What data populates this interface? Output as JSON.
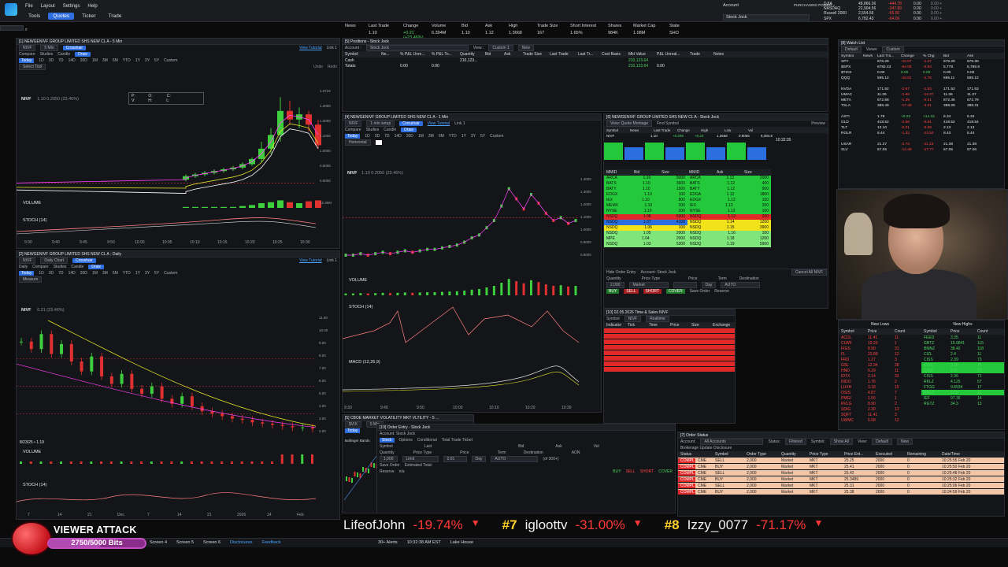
{
  "menu": [
    "File",
    "Layout",
    "Settings",
    "Help"
  ],
  "submenu": [
    {
      "label": "Tools",
      "active": false
    },
    {
      "label": "Quotes",
      "active": true
    },
    {
      "label": "Ticker",
      "active": false
    },
    {
      "label": "Trade",
      "active": false
    }
  ],
  "account": {
    "label": "Account",
    "value": "Stock Jock",
    "power_label": "PURCHASING POWER ="
  },
  "indices": [
    {
      "name": "DJIA",
      "value": "48,866.36",
      "change": "-444.78"
    },
    {
      "name": "NASDAQ",
      "value": "22,904.56",
      "change": "-347.89"
    },
    {
      "name": "Russell 2000",
      "value": "2,554.56",
      "change": "-55.00"
    },
    {
      "name": "SPX",
      "value": "6,782.43",
      "change": "-64.09"
    }
  ],
  "index_extra": [
    {
      "value": "0.00",
      "change": "0.00 +"
    },
    {
      "value": "0.00",
      "change": "0.00 +"
    },
    {
      "value": "0.00",
      "change": "0.00 +"
    },
    {
      "value": "0.00",
      "change": "0.00 +"
    }
  ],
  "quote_strip": {
    "labels": [
      "News",
      "Last Trade",
      "Change",
      "Volume",
      "Bid",
      "Ask",
      "High",
      "Trade Size",
      "Short Interest",
      "Shares",
      "Market Cap",
      "State"
    ],
    "values": [
      "",
      "1.10",
      "+0.21 (+23.46%)",
      "6.394M",
      "1.10",
      "1.12",
      "1.3668",
      "167",
      "1.65%",
      "984K",
      "1.08M",
      "SHO"
    ]
  },
  "positions": {
    "title": "[5] Positions - Stock Jock",
    "account": "Stock Jock",
    "view": "Custom 1",
    "new_label": "New",
    "columns": [
      "Symbol",
      "Ne...",
      "% P&L Unre...",
      "% P&L To...",
      "Quantity",
      "Bid",
      "Ask",
      "Trade Size",
      "Last Trade",
      "Last Tr...",
      "Cost Basis",
      "Mkt Value",
      "P&L Unreal...",
      "Trade",
      "Notes"
    ],
    "rows": [
      [
        "Cash",
        "",
        "",
        "",
        "210,123...",
        "",
        "",
        "",
        "",
        "",
        "",
        "210,123.64",
        "",
        "",
        ""
      ],
      [
        "Totals:",
        "",
        "0.00",
        "0.00",
        "",
        "",
        "",
        "",
        "",
        "",
        "",
        "210,123.64",
        "0.00",
        "",
        ""
      ]
    ]
  },
  "chart1": {
    "title": "[1] NEWGENIVF GROUP LIMITED SHS NEW CL A - 5 Min",
    "symbol": "NIVF",
    "timeframe": "5 Min",
    "tools": [
      "Compare",
      "Studies",
      "Candle",
      "Draw",
      "Crosshair"
    ],
    "tutorial": "View Tutorial",
    "link": "Link 1",
    "ranges": [
      "Today",
      "1D",
      "3D",
      "7D",
      "14D",
      "20D",
      "1M",
      "3M",
      "6M",
      "YTD",
      "1Y",
      "3Y",
      "5Y",
      "Custom"
    ],
    "select_tool": "Select Tool",
    "undo": "Undo",
    "redo": "Redo",
    "legend": "NIVF",
    "legend_price": "1.10 0.2050 (23.46%)",
    "ohlc": [
      "P:",
      "O:",
      "C:",
      "V:",
      "H:",
      "L:"
    ],
    "panes": [
      "VOLUME",
      "STOCH (14)"
    ],
    "times": [
      "9:30",
      "9:40",
      "9:45",
      "9:50",
      "10:00",
      "10:05",
      "10:10",
      "10:15",
      "10:20",
      "10:25",
      "10:30"
    ],
    "price_ticks": [
      "1.6722",
      "1.3000",
      "1.2000",
      "1.1000",
      "1.0000",
      "0.9000",
      "0.8000"
    ],
    "volume_label": "12.36M",
    "candles": [
      {
        "o": 0.9,
        "c": 0.92,
        "h": 0.93,
        "l": 0.89,
        "v": 1
      },
      {
        "o": 0.92,
        "c": 0.93,
        "h": 0.94,
        "l": 0.91,
        "v": 1
      },
      {
        "o": 0.93,
        "c": 0.94,
        "h": 0.95,
        "l": 0.92,
        "v": 1
      },
      {
        "o": 0.94,
        "c": 0.95,
        "h": 0.96,
        "l": 0.93,
        "v": 1
      },
      {
        "o": 0.95,
        "c": 0.96,
        "h": 0.97,
        "l": 0.94,
        "v": 1
      },
      {
        "o": 0.96,
        "c": 0.97,
        "h": 0.98,
        "l": 0.95,
        "v": 1
      },
      {
        "o": 0.97,
        "c": 0.99,
        "h": 1.0,
        "l": 0.96,
        "v": 2
      },
      {
        "o": 0.99,
        "c": 1.02,
        "h": 1.03,
        "l": 0.98,
        "v": 3
      },
      {
        "o": 1.02,
        "c": 1.08,
        "h": 1.12,
        "l": 1.0,
        "v": 5
      },
      {
        "o": 1.08,
        "c": 1.16,
        "h": 1.2,
        "l": 1.05,
        "v": 6
      },
      {
        "o": 1.16,
        "c": 1.3,
        "h": 1.38,
        "l": 1.12,
        "v": 8
      },
      {
        "o": 1.3,
        "c": 1.25,
        "h": 1.36,
        "l": 1.22,
        "v": 6
      },
      {
        "o": 1.25,
        "c": 1.28,
        "h": 1.32,
        "l": 1.2,
        "v": 5
      },
      {
        "o": 1.28,
        "c": 1.22,
        "h": 1.3,
        "l": 1.18,
        "v": 7
      },
      {
        "o": 1.22,
        "c": 1.1,
        "h": 1.25,
        "l": 1.08,
        "v": 8
      }
    ]
  },
  "chart2": {
    "title": "[4] NEWGENIVF GROUP LIMITED SHS NEW CL A - 1 Min",
    "symbol": "NIVF",
    "setup": "1 min setup",
    "tutorial": "View Tutorial",
    "link": "Link 1",
    "ranges": [
      "Today",
      "1D",
      "3D",
      "7D",
      "14D",
      "20D",
      "1M",
      "3M",
      "6M",
      "YTD",
      "1Y",
      "3Y",
      "5Y",
      "Custom"
    ],
    "draw_mode": "Horizontal",
    "legend": "NIVF",
    "legend_price": "1.10 0.2050 (23.46%)",
    "panes": [
      "VOLUME",
      "STOCH (14)",
      "MACD (12,26,9)"
    ],
    "times": [
      "9:30",
      "9:40",
      "9:50",
      "10:00",
      "10:10",
      "10:20",
      "10:30"
    ],
    "price_ticks": [
      "1.4000",
      "1.3000",
      "1.2000",
      "1.1000",
      "1.0000",
      "0.9000",
      "0.8000"
    ],
    "prices": [
      0.86,
      0.86,
      0.87,
      0.86,
      0.87,
      0.88,
      0.87,
      0.88,
      0.89,
      0.88,
      0.89,
      0.9,
      0.9,
      0.91,
      0.92,
      0.93,
      0.95,
      0.98,
      1.0,
      1.05,
      1.1,
      1.2,
      1.32,
      1.25,
      1.18,
      1.28,
      1.22,
      1.15,
      1.1,
      1.12,
      1.08,
      1.1
    ]
  },
  "chart3": {
    "title": "[2] NEWGENIVF GROUP LIMITED SHS NEW CL A - Daily",
    "symbol": "NIVF",
    "timeframe": "Daily",
    "chart": "Daily Chart",
    "tutorial": "View Tutorial",
    "link": "Link 1",
    "ranges": [
      "Today",
      "1D",
      "3D",
      "7D",
      "14D",
      "20D",
      "1M",
      "3M",
      "6M",
      "YTD",
      "1Y",
      "3Y",
      "5Y",
      "Custom"
    ],
    "measure": "Measure",
    "legend": "NIVF",
    "legend_price": "6.21 (23.46%)",
    "panes": [
      "VOLUME",
      "STOCH (14)"
    ],
    "dates": [
      "7",
      "14",
      "21",
      "Dec",
      "7",
      "14",
      "21",
      "2026",
      "14",
      "Feb"
    ],
    "date_marker": "8/23/25 • 1.19",
    "price_ticks": [
      "11.00",
      "10.00",
      "9.00",
      "8.00",
      "7.00",
      "6.00",
      "5.00",
      "4.00",
      "3.00",
      "2.00"
    ],
    "prices": [
      8.8,
      8.2,
      9.4,
      7.8,
      8.6,
      7.2,
      6.4,
      7.6,
      6.0,
      5.4,
      6.2,
      5.0,
      4.6,
      5.2,
      4.2,
      3.8,
      4.4,
      3.6,
      3.2,
      3.0,
      2.8,
      2.6,
      2.5,
      2.3,
      2.2,
      2.1,
      2.0,
      1.9,
      1.9,
      1.8
    ]
  },
  "vix": {
    "title": "[5] CBOE MARKET VOLATILITY MKT VLTILITY - 5 ...",
    "symbol": "$VIX",
    "timeframe": "5 Min",
    "today": "Today",
    "studies": "Bollinger Bands"
  },
  "level2": {
    "title": "[6] NEWGENIVF GROUP LIMITED SHS NEW CL A - Stock Jock",
    "view": "View: Quote Montage",
    "find": "Find Symbol",
    "preview": "Preview",
    "symbol": "NIVF",
    "quote_cols": [
      "Symbol",
      "News",
      "Last Trade",
      "Change",
      "High",
      "Low",
      "Vol"
    ],
    "quote_vals": [
      "NIVF",
      "",
      "1.10",
      "+0.209",
      "+0.23",
      "1.3668",
      "0.9056",
      "6,394.6"
    ],
    "time": "10:32:35",
    "book_cols": [
      "MMID",
      "Bid",
      "Size",
      "MMID",
      "Ask",
      "Size"
    ],
    "bids": [
      {
        "mmid": "ARCA",
        "price": "1.10",
        "size": "5000",
        "c": "g"
      },
      {
        "mmid": "BATS",
        "price": "1.10",
        "size": "3600",
        "c": "g"
      },
      {
        "mmid": "BATY",
        "price": "1.10",
        "size": "1500",
        "c": "g"
      },
      {
        "mmid": "EDGX",
        "price": "1.10",
        "size": "100",
        "c": "g"
      },
      {
        "mmid": "IEX",
        "price": "1.10",
        "size": "800",
        "c": "g"
      },
      {
        "mmid": "MEMX",
        "price": "1.10",
        "size": "200",
        "c": "g"
      },
      {
        "mmid": "NYSE",
        "price": "1.10",
        "size": "200",
        "c": "g"
      },
      {
        "mmid": "NSDQ",
        "price": "1.08",
        "size": "5300",
        "c": "rd"
      },
      {
        "mmid": "NSDQ",
        "price": "1.07",
        "size": "4100",
        "c": "bl"
      },
      {
        "mmid": "NSDQ",
        "price": "1.06",
        "size": "100",
        "c": "yl"
      },
      {
        "mmid": "NSDQ",
        "price": "1.05",
        "size": "2000",
        "c": "lg"
      },
      {
        "mmid": "MPE",
        "price": "1.04",
        "size": "2000",
        "c": "lg"
      },
      {
        "mmid": "NSDQ",
        "price": "1.03",
        "size": "5300",
        "c": "lg"
      }
    ],
    "asks": [
      {
        "mmid": "ARCA",
        "price": "1.12",
        "size": "2000",
        "c": "g"
      },
      {
        "mmid": "BATS",
        "price": "1.12",
        "size": "400",
        "c": "g"
      },
      {
        "mmid": "BATY",
        "price": "1.12",
        "size": "900",
        "c": "g"
      },
      {
        "mmid": "EDGA",
        "price": "1.12",
        "size": "1800",
        "c": "g"
      },
      {
        "mmid": "EDGX",
        "price": "1.12",
        "size": "100",
        "c": "g"
      },
      {
        "mmid": "IEX",
        "price": "1.12",
        "size": "200",
        "c": "g"
      },
      {
        "mmid": "NYSE",
        "price": "1.12",
        "size": "100",
        "c": "g"
      },
      {
        "mmid": "NSDQ",
        "price": "1.13",
        "size": "200",
        "c": "rd"
      },
      {
        "mmid": "NSDQ",
        "price": "1.14",
        "size": "1200",
        "c": "yl"
      },
      {
        "mmid": "NSDQ",
        "price": "1.15",
        "size": "3900",
        "c": "yl"
      },
      {
        "mmid": "NSDQ",
        "price": "1.16",
        "size": "100",
        "c": "lg"
      },
      {
        "mmid": "NSDQ",
        "price": "1.18",
        "size": "1200",
        "c": "lg"
      },
      {
        "mmid": "NSDQ",
        "price": "1.19",
        "size": "5900",
        "c": "lg"
      }
    ],
    "order_entry": {
      "hide": "Hide Order Entry",
      "account": "Account: Stock Jock",
      "cancel": "Cancel All NIVF",
      "qty_label": "Quantity",
      "qty": "2,000",
      "price_type_label": "Price Type",
      "price_type": "Market",
      "price_label": "Price",
      "term_label": "Term",
      "term": "Day",
      "dest_label": "Destination",
      "dest": "AUTO",
      "buttons": [
        "BUY",
        "SELL",
        "SHORT",
        "COVER"
      ],
      "save_order": "Save Order",
      "reserve": "Reserve"
    }
  },
  "tns": {
    "title": "[10] 02.05.2026 Time & Sales NIVF",
    "symbol": "NIVF",
    "mode": "Realtime",
    "columns": [
      "Indicator",
      "Tick",
      "Time",
      "Price",
      "Size",
      "Exchange"
    ]
  },
  "order_entry2": {
    "title": "[19] Order Entry - Stock Jock",
    "account": "Account: Stock Jock",
    "tabs": [
      "Stock",
      "Options",
      "Conditional",
      "Total Trade Ticket"
    ],
    "labels": [
      "Symbol",
      "Last",
      "Bid",
      "Ask",
      "Vol"
    ],
    "qty_label": "Quantity",
    "qty": "1,000",
    "price_type_label": "Price Type",
    "price_type": "Limit",
    "price_label": "Price",
    "price": "2.01",
    "term_label": "Term",
    "term": "Day",
    "dest_label": "Destination",
    "dest": "AUTO",
    "aon": "AON",
    "of": "(of 300+)",
    "save_order": "Save Order",
    "reserve": "Reserve",
    "est_total": "Estimated Total:",
    "est_value": "n/a",
    "buttons": [
      "BUY",
      "SELL",
      "SHORT",
      "COVER"
    ]
  },
  "watchlist": {
    "title": "[8] Watch List",
    "view": "Custom",
    "list": "Default",
    "columns": [
      "Symbol",
      "News",
      "Last Tra...",
      "Change",
      "% Chg",
      "Bid",
      "Ask"
    ],
    "rows": [
      [
        "SPY",
        "",
        "676.29",
        "-10.07",
        "-1.47",
        "676.29",
        "676.30"
      ],
      [
        "$SPX",
        "",
        "6782.43",
        "-64.09",
        "-0.94",
        "5,779.",
        "6,786.6"
      ],
      [
        "$TICK",
        "",
        "0.00",
        "0.00",
        "0.00",
        "0.00",
        "0.00"
      ],
      [
        "QQQ",
        "",
        "595.12",
        "-10.51",
        "-1.76",
        "595.11",
        "595.12"
      ],
      [
        "",
        "",
        "",
        "",
        "",
        "",
        ""
      ],
      [
        "NVDA",
        "",
        "171.52",
        "-2.67",
        "-1.53",
        "171.52",
        "171.53"
      ],
      [
        "UMAC",
        "",
        "11.36",
        "-1.89",
        "-14.27",
        "11.36",
        "11.37"
      ],
      [
        "META",
        "",
        "672.68",
        "-1.39",
        "-0.21",
        "672.46",
        "672.79"
      ],
      [
        "TSLA",
        "",
        "388.49",
        "-17.48",
        "-4.31",
        "388.28",
        "388.31"
      ],
      [
        "",
        "",
        "",
        "",
        "",
        "",
        ""
      ],
      [
        "ASTI",
        "",
        "1.78",
        "+0.22",
        "+14.15",
        "6.34",
        "6.34"
      ],
      [
        "GLD",
        "",
        "418.52",
        "-2.56",
        "-0.61",
        "418.52",
        "418.54"
      ],
      [
        "TLT",
        "",
        "13.10",
        "-0.01",
        "-0.08",
        "2.13",
        "2.13"
      ],
      [
        "ROLR",
        "",
        "8.44",
        "-1.32",
        "-13.52",
        "8.43",
        "8.44"
      ],
      [
        "",
        "",
        "",
        "",
        "",
        "",
        ""
      ],
      [
        "USAR",
        "",
        "21.37",
        "-2.73",
        "-11.33",
        "21.36",
        "21.38"
      ],
      [
        "SLV",
        "",
        "67.05",
        "-14.49",
        "-17.77",
        "67.05",
        "67.06"
      ]
    ]
  },
  "hilo": {
    "lows_title": "New Lows",
    "highs_title": "New Highs",
    "columns": [
      "Symbol",
      "Price",
      "Count"
    ],
    "lows": [
      [
        "ACDL",
        "11.41",
        "11"
      ],
      [
        "CLWF",
        "10.20",
        "1"
      ],
      [
        "FIGS",
        "8.90",
        "31"
      ],
      [
        "FL",
        "23.89",
        "12"
      ],
      [
        "FRD",
        "1.27",
        "3"
      ],
      [
        "GSL",
        "12.34",
        "28"
      ],
      [
        "HND",
        "6.29",
        "11"
      ],
      [
        "IDTX",
        "2.14",
        "33"
      ],
      [
        "INDO",
        "1.76",
        "2"
      ],
      [
        "LUXH",
        "3.18",
        "15"
      ],
      [
        "OSIS",
        "4.87",
        "7"
      ],
      [
        "PMGI",
        "1.55",
        "1"
      ],
      [
        "RVLG",
        "8.90",
        "2"
      ],
      [
        "SDIG",
        "2.30",
        "13"
      ],
      [
        "SQFT",
        "11.41",
        "3"
      ],
      [
        "UWMC",
        "6.08",
        "12"
      ]
    ],
    "highs": [
      [
        "FEED",
        "3.35",
        "11"
      ],
      [
        "GBTZ",
        "15.9841",
        "115"
      ],
      [
        "BMNZ",
        "38.42",
        "118"
      ],
      [
        "CIZL",
        "2.4",
        "11"
      ],
      [
        "CISS",
        "2.39",
        "73"
      ],
      [
        "CISS",
        "2.38",
        "75"
      ],
      [
        "CISS",
        "2.37",
        "71"
      ],
      [
        "CISS",
        "2.36",
        "71"
      ],
      [
        "RKLZ",
        "4.125",
        "57"
      ],
      [
        "FTGG",
        "9.8934",
        "17"
      ],
      [
        "RGTZ",
        "9.55",
        "12"
      ],
      [
        "IEF",
        "97.36",
        "14"
      ],
      [
        "RGTZ",
        "34.3",
        "13"
      ]
    ]
  },
  "orderstatus": {
    "title": "[7] Order Status",
    "account": "All Accounts",
    "status": "Filtered",
    "symbol": "Show All",
    "view": "Default",
    "new_label": "New",
    "disclosure": "Brokerage Update Disclosure",
    "columns": [
      "Status",
      "Symbol",
      "Order Type",
      "Quantity",
      "Price Type",
      "Price Ent...",
      "Executed",
      "Remaining",
      "Date/Time"
    ],
    "rows": [
      [
        "COMPL",
        "CME",
        "SELL",
        "2,000",
        "Market",
        "MKT",
        "25.25",
        "2000",
        "0",
        "10:25:55 Feb 20"
      ],
      [
        "COMPL",
        "CME",
        "BUY",
        "2,000",
        "Market",
        "MKT",
        "25.41",
        "2000",
        "0",
        "10:25:50 Feb 20"
      ],
      [
        "COMPL",
        "CME",
        "SELL",
        "2,000",
        "Market",
        "MKT",
        "25.42",
        "2000",
        "0",
        "10:25:48 Feb 20"
      ],
      [
        "COMPL",
        "CME",
        "BUY",
        "2,000",
        "Market",
        "MKT",
        "25.3489",
        "2000",
        "0",
        "10:25:32 Feb 20"
      ],
      [
        "COMPL",
        "CME",
        "SELL",
        "2,000",
        "Market",
        "MKT",
        "25.31",
        "2000",
        "0",
        "10:25:06 Feb 20"
      ],
      [
        "COMPL",
        "CME",
        "BUY",
        "2,000",
        "Market",
        "MKT",
        "25.38",
        "2000",
        "0",
        "10:24:59 Feb 20"
      ]
    ]
  },
  "ticker": [
    {
      "rank": "",
      "name": "LifeofJohn",
      "pct": "-19.74%"
    },
    {
      "rank": "#7",
      "name": "igloottv",
      "pct": "-31.00%"
    },
    {
      "rank": "#8",
      "name": "Izzy_0077",
      "pct": "-71.17%"
    }
  ],
  "viewer_attack": {
    "title": "VIEWER ATTACK",
    "bits": "2750/5000 Bits",
    "progress": 0.55
  },
  "bottom": {
    "screens": [
      "Screen 4",
      "Screen 5",
      "Screen 6"
    ],
    "disclosures": "Disclosures",
    "feedback": "Feedback",
    "alerts": "30+ Alerts",
    "clock": "10:32:38 AM EST",
    "location": "Lake House"
  },
  "colors": {
    "up": "#4cd964",
    "down": "#ff4545",
    "accent": "#2f6fe0",
    "candle_up": "#3ecf3e",
    "candle_down": "#e03030"
  }
}
